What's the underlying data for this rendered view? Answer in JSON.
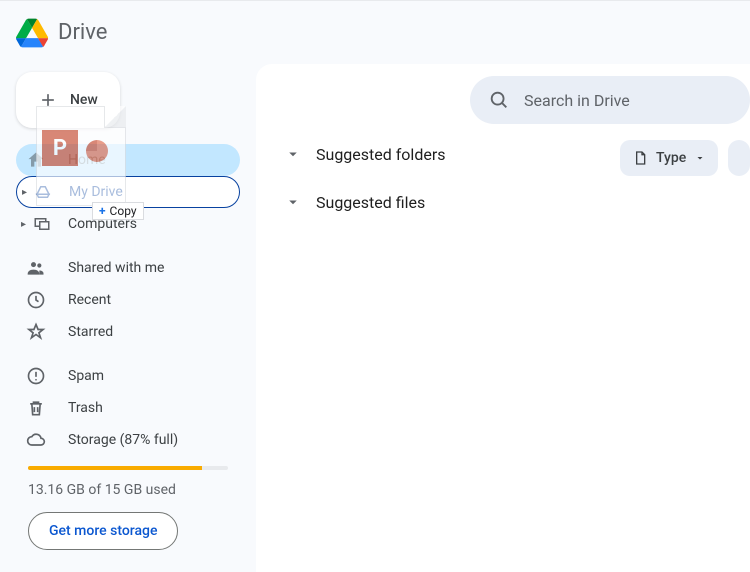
{
  "app": {
    "title": "Drive"
  },
  "new_button": {
    "label": "New"
  },
  "sidebar": {
    "home": "Home",
    "my_drive": "My Drive",
    "computers": "Computers",
    "shared": "Shared with me",
    "recent": "Recent",
    "starred": "Starred",
    "spam": "Spam",
    "trash": "Trash",
    "storage_label": "Storage (87% full)",
    "storage_used": "13.16 GB of 15 GB used",
    "get_more": "Get more storage"
  },
  "search": {
    "placeholder": "Search in Drive"
  },
  "chips": {
    "type": "Type"
  },
  "suggest": {
    "folders": "Suggested folders",
    "files": "Suggested files"
  },
  "drag": {
    "letter": "P",
    "copy_label": "Copy"
  },
  "storage_pct": 87
}
